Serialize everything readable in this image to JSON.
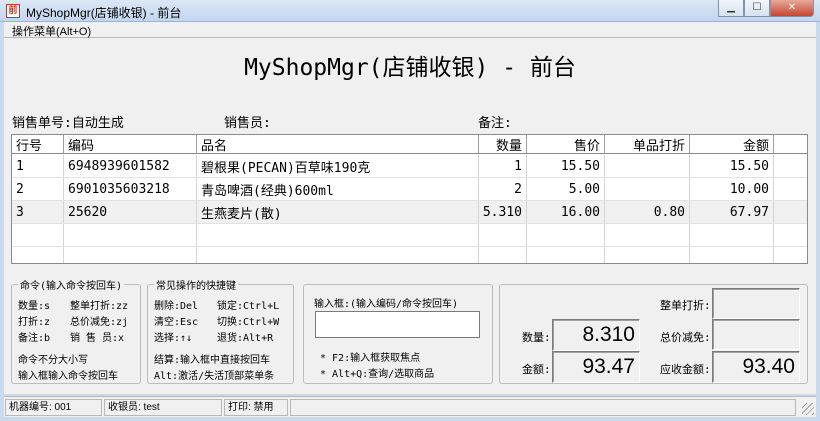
{
  "window": {
    "title": "MyShopMgr(店铺收银) - 前台",
    "icon": "app-icon",
    "icon_text": "前"
  },
  "menu": {
    "label": "操作菜单(Alt+O)"
  },
  "header": {
    "title": "MyShopMgr(店铺收银) - 前台",
    "order_label": "销售单号:自动生成",
    "seller_label": "销售员:",
    "note_label": "备注:"
  },
  "table": {
    "columns": [
      "行号",
      "编码",
      "品名",
      "数量",
      "售价",
      "单品打折",
      "金额"
    ],
    "rows": [
      {
        "no": "1",
        "code": "6948939601582",
        "name": "碧根果(PECAN)百草味190克",
        "qty": "1",
        "price": "15.50",
        "discount": "",
        "amount": "15.50"
      },
      {
        "no": "2",
        "code": "6901035603218",
        "name": "青岛啤酒(经典)600ml",
        "qty": "2",
        "price": "5.00",
        "discount": "",
        "amount": "10.00"
      },
      {
        "no": "3",
        "code": "25620",
        "name": "生燕麦片(散)",
        "qty": "5.310",
        "price": "16.00",
        "discount": "0.80",
        "amount": "67.97"
      }
    ]
  },
  "commands": {
    "title": "命令(输入命令按回车)",
    "lines": [
      "数量:s",
      "整单打折:zz",
      "打折:z",
      "总价减免:zj",
      "备注:b",
      "销 售 员:x"
    ],
    "note1": "命令不分大小写",
    "note2": "输入框输入命令按回车"
  },
  "shortcuts": {
    "title": "常见操作的快捷键",
    "lines": [
      "删除:Del",
      "锁定:Ctrl+L",
      "清空:Esc",
      "切换:Ctrl+W",
      "选择:↑↓",
      "退货:Alt+R"
    ],
    "note1": "结算:输入框中直接按回车",
    "note2": "Alt:激活/失活顶部菜单条"
  },
  "input": {
    "label": "输入框:(输入编码/命令按回车)",
    "value": "",
    "hint1": "* F2:输入框获取焦点",
    "hint2": "* Alt+Q:查询/选取商品"
  },
  "totals": {
    "qty_label": "数量:",
    "qty_value": "8.310",
    "amount_label": "金额:",
    "amount_value": "93.47",
    "whole_discount_label": "整单打折:",
    "whole_discount_value": "",
    "reduction_label": "总价减免:",
    "reduction_value": "",
    "receivable_label": "应收金额:",
    "receivable_value": "93.40"
  },
  "status": {
    "machine": "机器编号: 001",
    "cashier": "收银员: test",
    "print": "打印: 禁用"
  }
}
